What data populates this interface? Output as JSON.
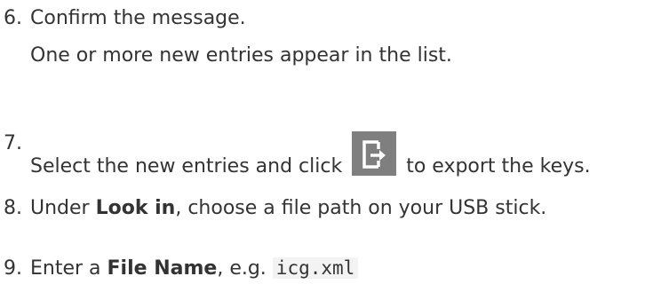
{
  "steps": [
    {
      "number": "6.",
      "text": "Confirm the message.",
      "subtext": "One or more new entries appear in the list."
    },
    {
      "number": "7.",
      "text_before": "Select the new entries and click",
      "icon": "export-icon",
      "text_after": "to export the keys."
    },
    {
      "number": "8.",
      "text_prefix": "Under ",
      "bold": "Look in",
      "text_suffix": ", choose a file path on your USB stick."
    },
    {
      "number": "9.",
      "text_prefix": "Enter a ",
      "bold": "File Name",
      "text_middle": ", e.g. ",
      "code": "icg.xml"
    }
  ],
  "colors": {
    "text": "#333333",
    "icon_background": "#7f7f7f",
    "code_background": "#f3f3f3"
  }
}
